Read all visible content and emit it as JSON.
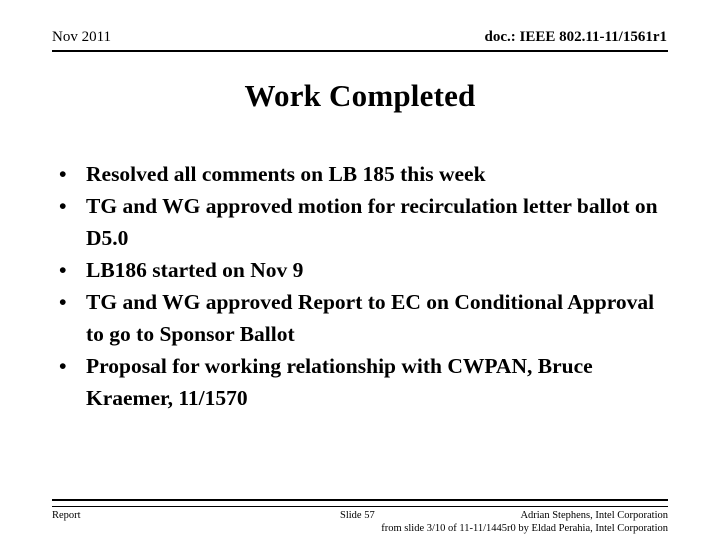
{
  "slide": {
    "header": {
      "date": "Nov 2011",
      "doc_id": "doc.: IEEE 802.11-11/1561r1"
    },
    "title": "Work Completed",
    "bullet_marker": "•",
    "bullets": [
      {
        "text": "Resolved all comments on LB 185 this week"
      },
      {
        "text": "TG and WG approved motion for recirculation letter ballot on D5.0"
      },
      {
        "text": "LB186 started on Nov 9"
      },
      {
        "text": "TG and WG approved Report to EC on Conditional Approval to go to Sponsor Ballot"
      },
      {
        "text": "Proposal for working relationship with CWPAN, Bruce Kraemer, 11/1570"
      }
    ],
    "footer": {
      "left": "Report",
      "slide_number": "Slide 57",
      "author": "Adrian Stephens, Intel Corporation",
      "source_note": "from slide 3/10 of 11-11/1445r0 by Eldad Perahia, Intel Corporation"
    }
  }
}
